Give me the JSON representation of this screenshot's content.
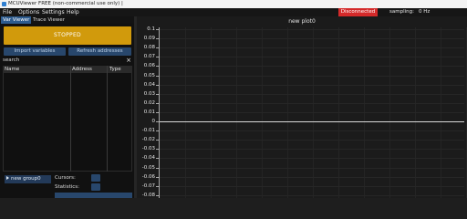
{
  "window": {
    "title": "MCUViewer FREE (non-commercial use only) |"
  },
  "menu": {
    "items": [
      "File",
      "Options",
      "Settings",
      "Help"
    ]
  },
  "status": {
    "connection": "Disconnected",
    "connection_color": "#d42a2a",
    "sampling_label": "sampling:",
    "sampling_value": "0 Hz"
  },
  "tabs": [
    {
      "label": "Var Viewer",
      "active": true
    },
    {
      "label": "Trace Viewer",
      "active": false
    }
  ],
  "controls": {
    "stop_button": "STOPPED",
    "stop_button_color": "#d19a0c",
    "import_button": "Import variables",
    "refresh_button": "Refresh addresses"
  },
  "search": {
    "label": "search",
    "value": "",
    "clear_icon": "close-icon"
  },
  "var_table": {
    "headers": [
      "Name",
      "Address",
      "Type"
    ],
    "rows": []
  },
  "group": {
    "button_label": "new group0",
    "icon": "play-icon"
  },
  "side": {
    "cursors_label": "Cursors:",
    "statistics_label": "Statistics:"
  },
  "plot": {
    "title": "new plot0",
    "y_ticks": [
      "0.1",
      "0.09",
      "0.08",
      "0.07",
      "0.06",
      "0.05",
      "0.04",
      "0.03",
      "0.02",
      "0.01",
      "0",
      "-0.01",
      "-0.02",
      "-0.03",
      "-0.04",
      "-0.05",
      "-0.06",
      "-0.07",
      "-0.08"
    ]
  }
}
